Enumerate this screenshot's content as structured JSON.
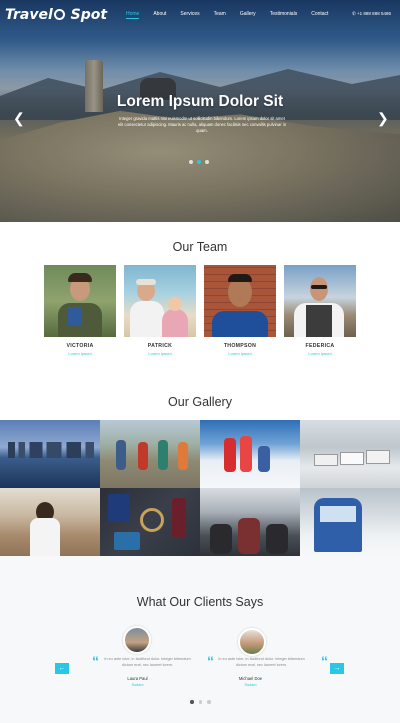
{
  "brand": {
    "logo_left": "Travel",
    "logo_right": "Spot"
  },
  "nav": {
    "items": [
      {
        "label": "Home",
        "active": true
      },
      {
        "label": "About"
      },
      {
        "label": "Services"
      },
      {
        "label": "Team"
      },
      {
        "label": "Gallery"
      },
      {
        "label": "Testimonials"
      },
      {
        "label": "Contact"
      }
    ],
    "phone": "+1 888 888 5486"
  },
  "hero": {
    "title": "Lorem Ipsum Dolor Sit",
    "text": "Integer gravida mattis nisi euismodm ut sollicitudin bibendum. Lorem ipsum dolor sit amet elit consectetur adipiscing. Mauris ac nulla, aliquam donec facilisis nec convallis pulvinar in quam.",
    "prev_icon": "chevron-left-icon",
    "next_icon": "chevron-right-icon",
    "slides": 3,
    "active_slide": 1
  },
  "team": {
    "title": "Our Team",
    "members": [
      {
        "name": "VICTORIA",
        "role": "Lorem Ipsum"
      },
      {
        "name": "PATRICK",
        "role": "Lorem Ipsum"
      },
      {
        "name": "THOMPSON",
        "role": "Lorem Ipsum"
      },
      {
        "name": "FEDERICA",
        "role": "Lorem Ipsum"
      }
    ]
  },
  "gallery": {
    "title": "Our Gallery",
    "tiles": [
      "city-skyline",
      "hikers-group",
      "snow-friends",
      "street-trams",
      "photographer-girl",
      "travel-items",
      "airplane-cabin",
      "tram-in-snow"
    ]
  },
  "clients": {
    "title": "What Our Clients Says",
    "testimonials": [
      {
        "quote": "In eu ante lobe, in faclifond dolor. Integer bibendum dictum erat, nec laoreet lorem.",
        "name": "Laura Paul",
        "role": "Sodam"
      },
      {
        "quote": "In eu ante lobe, in faclifond dolor. Integer bibendum dictum erat, nec laoreet lorem.",
        "name": "Michael Doe",
        "role": "Sodam"
      }
    ],
    "prev_icon": "arrow-left-icon",
    "next_icon": "arrow-right-icon",
    "dots": 3,
    "active_dot": 0
  },
  "colors": {
    "accent": "#29c6e6",
    "text": "#333333",
    "muted": "#888888"
  }
}
